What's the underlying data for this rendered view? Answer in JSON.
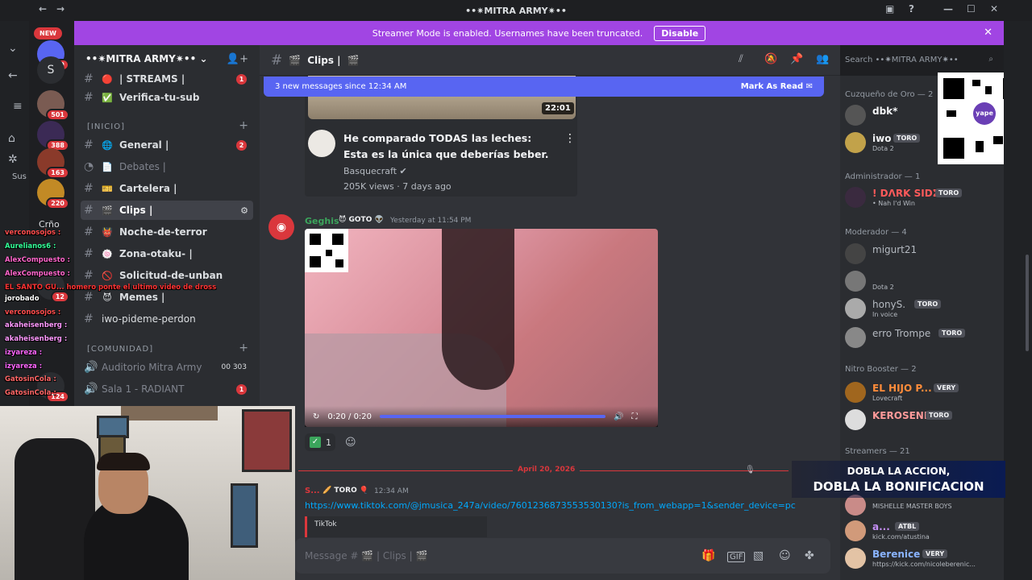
{
  "window": {
    "title": "••✷MITRA ARMY✷••",
    "controls": [
      "minimize",
      "maximize",
      "close"
    ]
  },
  "banner": {
    "text": "Streamer Mode is enabled. Usernames have been truncated.",
    "button": "Disable"
  },
  "rail": {
    "new_label": "NEW",
    "badges": [
      "409",
      "501",
      "388",
      "163",
      "220",
      "12",
      "124"
    ],
    "server_letter": "S",
    "labels": [
      "Sus",
      "Crño"
    ]
  },
  "sidebar": {
    "server_name": "••✷MITRA ARMY✷••",
    "channels": [
      {
        "name": "| STREAMS |",
        "icon": "🔴",
        "count": "1"
      },
      {
        "name": "Verifica-tu-sub",
        "icon": "✅"
      },
      {
        "category": "[INICIO]"
      },
      {
        "name": "General |",
        "icon": "🌐",
        "count": "2"
      },
      {
        "name": "Debates |",
        "icon": "📄"
      },
      {
        "name": "Cartelera |",
        "icon": "🎫"
      },
      {
        "name": "Clips |",
        "icon": "🎬"
      },
      {
        "name": "Noche-de-terror",
        "icon": "👹"
      },
      {
        "name": "Zona-otaku- |",
        "icon": "🍥"
      },
      {
        "name": "Solicitud-de-unban",
        "icon": "🚫"
      },
      {
        "name": "Memes |",
        "icon": "😈"
      },
      {
        "name": "iwo-pideme-perdon",
        "icon": ""
      },
      {
        "category": "[COMUNIDAD]"
      },
      {
        "name": "Auditorio Mitra Army",
        "count_a": "00",
        "count_b": "303"
      },
      {
        "name": "Sala 1 - RADIANT",
        "count": "1"
      }
    ]
  },
  "header": {
    "channel": "Clips |",
    "search_placeholder": "Search ••✷MITRA ARMY✷••"
  },
  "new_messages": {
    "text": "3 new messages since 12:34 AM",
    "action": "Mark As Read"
  },
  "embed": {
    "duration": "22:01",
    "title": "He comparado TODAS las leches: Esta es la única que deberías beber.",
    "channel": "Basquecraft",
    "meta": "205K views · 7 days ago"
  },
  "message": {
    "author": "Geghis",
    "role": "GOTO",
    "time": "Yesterday at 11:54 PM",
    "video_time": "0:20 / 0:20",
    "reaction_count": "1"
  },
  "divider": {
    "date": "April 20, 2026"
  },
  "message2": {
    "author": "S...",
    "role": "TORO",
    "time": "12:34 AM",
    "link": "https://www.tiktok.com/@jmusica_247a/video/7601236873553530130?is_from_webapp=1&sender_device=pc",
    "embed_provider": "TikTok"
  },
  "composer": {
    "placeholder": "Message # 🎬 | Clips | 🎬"
  },
  "members": {
    "categories": [
      "Cuzqueño de Oro — 2",
      "Administrador — 1",
      "Moderador — 4",
      "Nitro Booster — 2",
      "Streamers — 21"
    ],
    "list": [
      {
        "name": "dbk*",
        "tag": "",
        "sub": ""
      },
      {
        "name": "iwo",
        "tag": "TORO",
        "sub": "Dota 2"
      },
      {
        "name": "! DΛRK SIDΣ",
        "tag": "TORO",
        "sub": "• Nah I'd Win"
      },
      {
        "name": "migurt21",
        "tag": "",
        "sub": ""
      },
      {
        "name": "",
        "tag": "",
        "sub": "Dota 2"
      },
      {
        "name": "honyS.",
        "tag": "TORO",
        "sub": "In voice"
      },
      {
        "name": "erro Trompe",
        "tag": "TORO",
        "sub": ""
      },
      {
        "name": "EL HIJO P...",
        "tag": "VERY",
        "sub": "Lovecraft"
      },
      {
        "name": "KEROSENE",
        "tag": "TORO",
        "sub": ""
      },
      {
        "name": "",
        "tag": "",
        "sub": "MISHELLE MASTER BOYS"
      },
      {
        "name": "a...",
        "tag": "ATBL",
        "sub": "kick.com/atustina"
      },
      {
        "name": "Berenice",
        "tag": "VERY",
        "sub": "https://kick.com/nicoleberenic..."
      }
    ]
  },
  "overlay": {
    "qr_label": "yape",
    "promo_line1": "DOBLA LA ACCION,",
    "promo_line2": "DOBLA LA BONIFICACION"
  },
  "stream_chat": [
    {
      "user": "verconosojos :",
      "color": "#ff4d4d"
    },
    {
      "user": "Aurelianos6 :",
      "color": "#33ff99"
    },
    {
      "user": "AlexCompuesto :",
      "color": "#ff66cc"
    },
    {
      "user": "AlexCompuesto :",
      "color": "#ff66cc"
    },
    {
      "user": "EL SANTO GU... homero ponte el ultimo video de dross",
      "color": "#ff3333"
    },
    {
      "user": "jorobado",
      "color": "#ffffff"
    },
    {
      "user": "verconosojos :",
      "color": "#ff4d4d"
    },
    {
      "user": "akaheisenberg :",
      "color": "#ff99ff"
    },
    {
      "user": "akaheisenberg :",
      "color": "#ff99ff"
    },
    {
      "user": "izyareza :",
      "color": "#ff66ff"
    },
    {
      "user": "izyareza :",
      "color": "#ff66ff"
    },
    {
      "user": "GatosinCola :",
      "color": "#ff6666"
    },
    {
      "user": "GatosinCola :",
      "color": "#ff6666"
    }
  ]
}
